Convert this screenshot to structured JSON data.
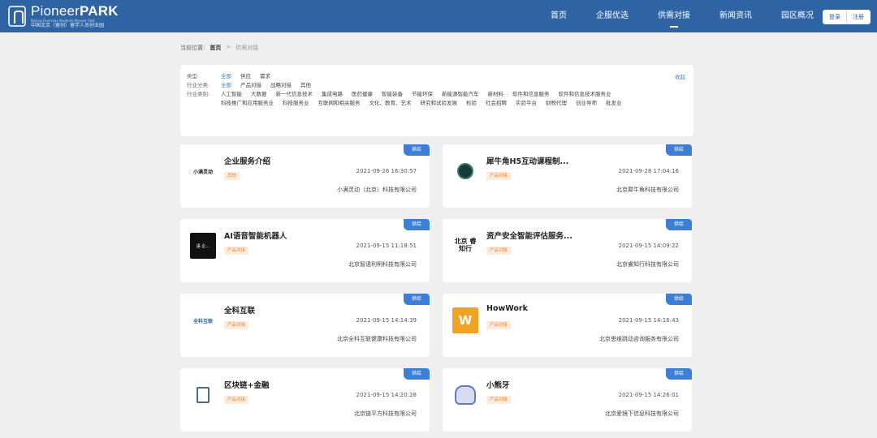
{
  "header": {
    "logo": {
      "name_light": "Pioneer",
      "name_bold": "PARK",
      "subtitle_en": "Beijing Overseas Students Pioneer Park",
      "subtitle_cn": "中国北京（留创）留学人员创业园"
    },
    "nav": [
      {
        "label": "首页",
        "active": false
      },
      {
        "label": "企服优选",
        "active": false
      },
      {
        "label": "供需对接",
        "active": true
      },
      {
        "label": "新闻资讯",
        "active": false
      },
      {
        "label": "园区概况",
        "active": false
      }
    ],
    "login_label": "登录",
    "register_label": "注册"
  },
  "breadcrumb": {
    "prefix": "当前位置:",
    "home": "首页",
    "separator": ">",
    "current": "供需对接"
  },
  "filters": {
    "collapse_label": "收起",
    "rows": [
      {
        "label": "类型:",
        "options": [
          "全部",
          "供应",
          "需求"
        ],
        "selected": 0
      },
      {
        "label": "行业分类:",
        "options": [
          "全部",
          "产品对接",
          "战略对接",
          "其他"
        ],
        "selected": 0
      },
      {
        "label": "行业类别:",
        "options": [
          "人工智能",
          "大数据",
          "新一代信息技术",
          "集成电路",
          "医药健康",
          "智能装备",
          "节能环保",
          "新能源智能汽车",
          "新材料",
          "软件和信息服务",
          "软件和信息技术服务业",
          "科技推广和应用服务业",
          "科技服务业",
          "互联网和相关服务",
          "文化、教育、艺术",
          "研究和试验发展",
          "检验",
          "社会招聘",
          "实验平台",
          "财税代理",
          "创业导师",
          "批发业"
        ],
        "selected": -1
      }
    ]
  },
  "cards": [
    {
      "title": "企业服务介绍",
      "tag": "供给",
      "badge": "其他",
      "date": "2021-09-26 16:30:57",
      "company": "小满灵动（北京）科技有限公司",
      "logo_text": "小满灵动",
      "logo_kind": "text"
    },
    {
      "title": "犀牛角H5互动课程制...",
      "tag": "供给",
      "badge": "产品对接",
      "date": "2021-09-28 17:04:16",
      "company": "北京犀牛角科技有限公司",
      "logo_text": "",
      "logo_kind": "circle"
    },
    {
      "title": "AI语音智能机器人",
      "tag": "供给",
      "badge": "产品对接",
      "date": "2021-09-15 11:18:51",
      "company": "北京智语利明科技有限公司",
      "logo_text": "语 企…",
      "logo_kind": "dark"
    },
    {
      "title": "资产安全智能评估服务...",
      "tag": "供给",
      "badge": "产品对接",
      "date": "2021-09-15 14:09:22",
      "company": "北京睿知行科技有限公司",
      "logo_text": "北京 睿知行",
      "logo_kind": "twoline"
    },
    {
      "title": "全科互联",
      "tag": "供给",
      "badge": "产品对接",
      "date": "2021-09-15 14:14:39",
      "company": "北京全科互联健康科技有限公司",
      "logo_text": "全科互联",
      "logo_kind": "blue"
    },
    {
      "title": "HowWork",
      "tag": "供给",
      "badge": "产品对接",
      "date": "2021-09-15 14:16:43",
      "company": "北京思维跳动咨询服务有限公司",
      "logo_text": "W",
      "logo_kind": "yellow"
    },
    {
      "title": "区块链+金融",
      "tag": "供给",
      "badge": "产品对接",
      "date": "2021-09-15 14:20:28",
      "company": "北京链平方科技有限公司",
      "logo_text": "链平方",
      "logo_kind": "doc"
    },
    {
      "title": "小熊牙",
      "tag": "供给",
      "badge": "产品对接",
      "date": "2021-09-15 14:26:01",
      "company": "北京爱镜下信息科技有限公司",
      "logo_text": "",
      "logo_kind": "bear"
    }
  ],
  "colors": {
    "header": "#2e63a4",
    "accent": "#3b7fd6",
    "badge_bg": "#fdecdc",
    "badge_text": "#e6883a"
  }
}
